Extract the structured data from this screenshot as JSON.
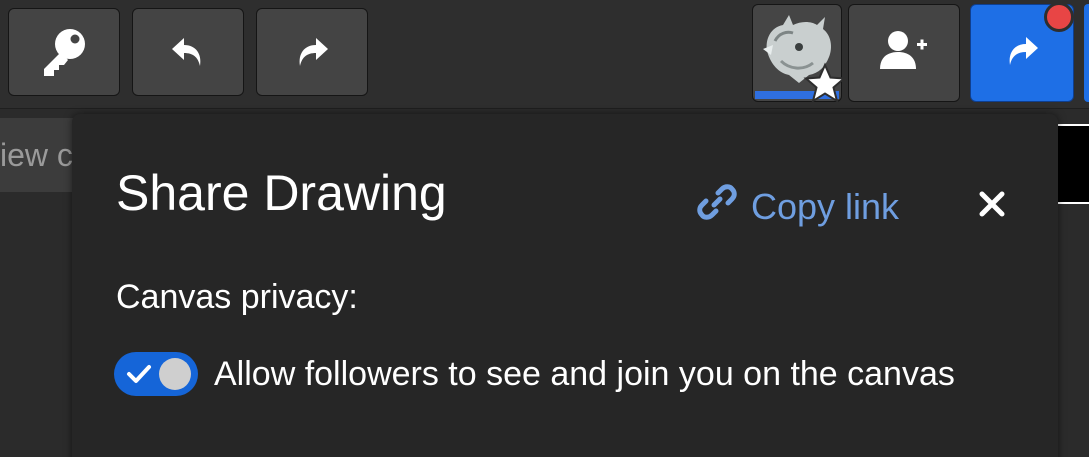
{
  "toolbar": {
    "buttons": [
      {
        "icon": "key-icon"
      },
      {
        "icon": "undo-icon"
      },
      {
        "icon": "redo-icon"
      }
    ],
    "avatar": {
      "icon": "rhino-avatar-icon",
      "badge_icon": "star-icon"
    },
    "invite": {
      "icon": "add-user-icon"
    },
    "share": {
      "icon": "share-arrow-icon",
      "color": "#1e6fe6"
    },
    "notification_color": "#e84545"
  },
  "background": {
    "tab_label": "iew c"
  },
  "dialog": {
    "title": "Share Drawing",
    "copy_link_label": "Copy link",
    "copy_link_color": "#6f9ee0",
    "close_icon": "close-icon",
    "privacy_heading": "Canvas privacy:",
    "toggle": {
      "checked": true,
      "label": "Allow followers to see and join you on the canvas",
      "color": "#1565d8"
    }
  }
}
